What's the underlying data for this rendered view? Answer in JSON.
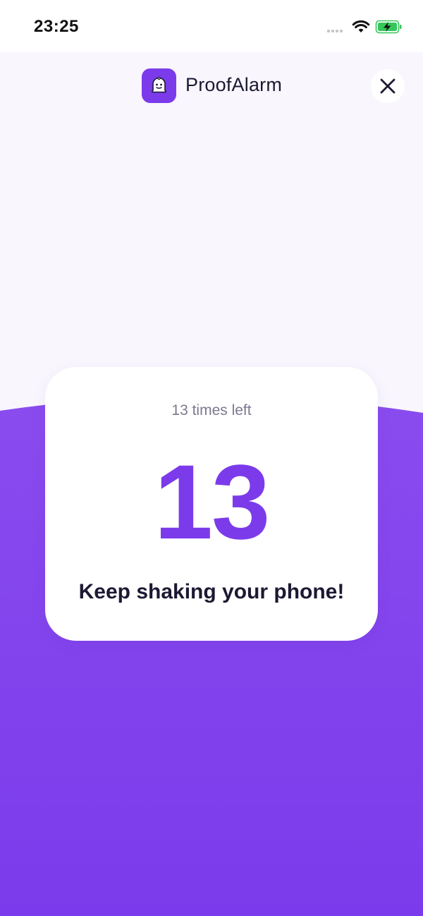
{
  "status_bar": {
    "time": "23:25",
    "icons": [
      "signal-dots-icon",
      "wifi-icon",
      "battery-charging-icon"
    ]
  },
  "header": {
    "app_name": "ProofAlarm",
    "logo_icon": "ghost-bell-icon",
    "close_icon": "close-icon"
  },
  "challenge": {
    "times_left_text": "13 times left",
    "count": "13",
    "message": "Keep shaking your phone!"
  },
  "colors": {
    "accent": "#7c3bea",
    "background_top": "#f9f6fe",
    "card": "#ffffff",
    "text_dark": "#1c1933",
    "text_muted": "#7d7891"
  }
}
